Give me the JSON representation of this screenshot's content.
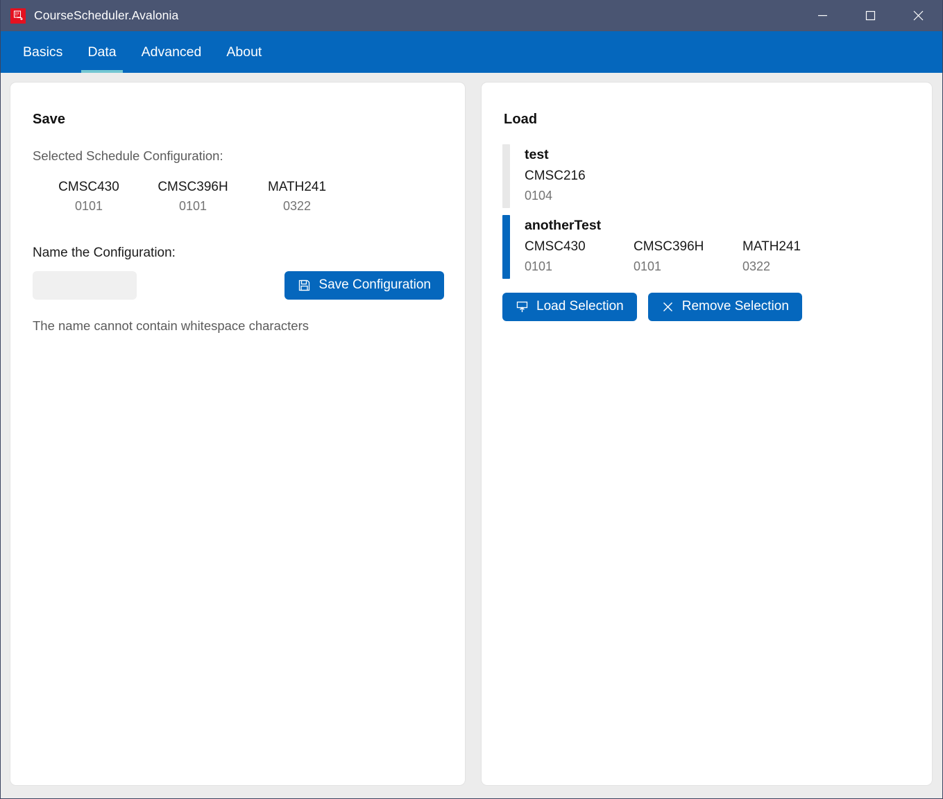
{
  "window": {
    "title": "CourseScheduler.Avalonia",
    "app_icon": "app-window-icon",
    "controls": {
      "minimize": "minimize-icon",
      "maximize": "maximize-icon",
      "close": "close-icon"
    },
    "colors": {
      "titlebar": "#4A5572",
      "accent": "#0567BD",
      "tab_underline": "#74C7D2",
      "page_background": "#ECECEC",
      "card_background": "#FFFFFF",
      "item_accent_unselected": "#E8E8E8",
      "item_accent_selected": "#0567BD"
    }
  },
  "tabs": [
    {
      "label": "Basics",
      "active": false
    },
    {
      "label": "Data",
      "active": true
    },
    {
      "label": "Advanced",
      "active": false
    },
    {
      "label": "About",
      "active": false
    }
  ],
  "save_panel": {
    "heading": "Save",
    "selected_label": "Selected Schedule Configuration:",
    "selected_courses": [
      {
        "name": "CMSC430",
        "section": "0101"
      },
      {
        "name": "CMSC396H",
        "section": "0101"
      },
      {
        "name": "MATH241",
        "section": "0322"
      }
    ],
    "name_label": "Name the Configuration:",
    "name_input_value": "",
    "name_input_placeholder": "",
    "save_button_label": "Save Configuration",
    "save_button_icon": "floppy-disk-icon",
    "hint": "The name cannot contain whitespace characters"
  },
  "load_panel": {
    "heading": "Load",
    "items": [
      {
        "name": "test",
        "selected": false,
        "courses": [
          {
            "name": "CMSC216",
            "section": "0104"
          }
        ]
      },
      {
        "name": "anotherTest",
        "selected": true,
        "courses": [
          {
            "name": "CMSC430",
            "section": "0101"
          },
          {
            "name": "CMSC396H",
            "section": "0101"
          },
          {
            "name": "MATH241",
            "section": "0322"
          }
        ]
      }
    ],
    "load_button_label": "Load Selection",
    "load_button_icon": "upload-tray-icon",
    "remove_button_label": "Remove Selection",
    "remove_button_icon": "close-x-icon"
  }
}
